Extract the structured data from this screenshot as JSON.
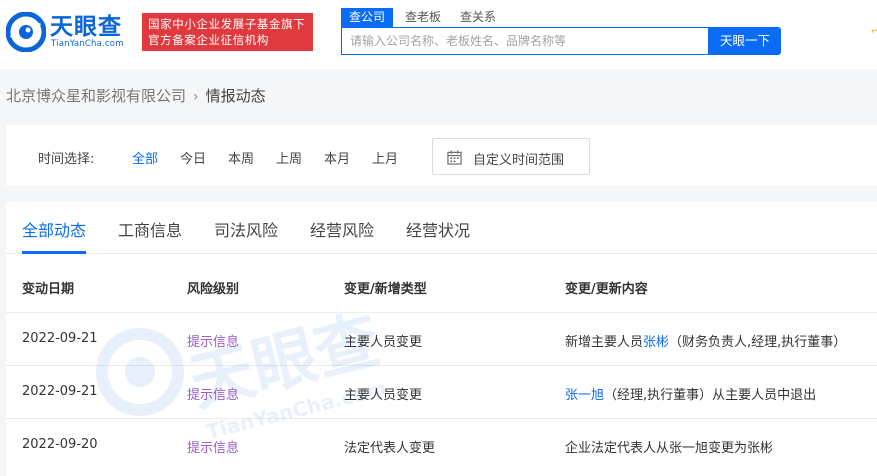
{
  "header": {
    "logo_name": "天眼查",
    "logo_domain": "TianYanCha.com",
    "badge_line1": "国家中小企业发展子基金旗下",
    "badge_line2": "官方备案企业征信机构",
    "search_tabs": [
      "查公司",
      "查老板",
      "查关系"
    ],
    "search_placeholder": "请输入公司名称、老板姓名、品牌名称等",
    "search_button": "天眼一下"
  },
  "breadcrumb": {
    "company": "北京博众星和影视有限公司",
    "current": "情报动态"
  },
  "time_filter": {
    "label": "时间选择:",
    "options": [
      "全部",
      "今日",
      "本周",
      "上周",
      "本月",
      "上月"
    ],
    "active_index": 0,
    "custom_range": "自定义时间范围"
  },
  "tabs": [
    "全部动态",
    "工商信息",
    "司法风险",
    "经营风险",
    "经营状况"
  ],
  "active_tab": 0,
  "table": {
    "headers": [
      "变动日期",
      "风险级别",
      "变更/新增类型",
      "变更/更新内容"
    ],
    "rows": [
      {
        "date": "2022-09-21",
        "risk": "提示信息",
        "type": "主要人员变更",
        "content_pre": "新增主要人员",
        "content_link": "张彬",
        "content_post": "（财务负责人,经理,执行董事）"
      },
      {
        "date": "2022-09-21",
        "risk": "提示信息",
        "type": "主要人员变更",
        "content_pre": "",
        "content_link": "张一旭",
        "content_post": "（经理,执行董事）从主要人员中退出"
      },
      {
        "date": "2022-09-20",
        "risk": "提示信息",
        "type": "法定代表人变更",
        "content_pre": "企业法定代表人从张一旭变更为张彬",
        "content_link": "",
        "content_post": ""
      }
    ]
  },
  "watermark": {
    "logo": "天眼查",
    "domain": "TianYanCha.com"
  },
  "colors": {
    "brand_blue": "#0a6cf5",
    "badge_red": "#e0393e",
    "risk_purple": "#9a5cc9"
  },
  "icons": {
    "logo": "tianyancha-eye-logo",
    "calendar": "calendar-icon",
    "breadcrumb_sep": "chevron-right-icon"
  }
}
